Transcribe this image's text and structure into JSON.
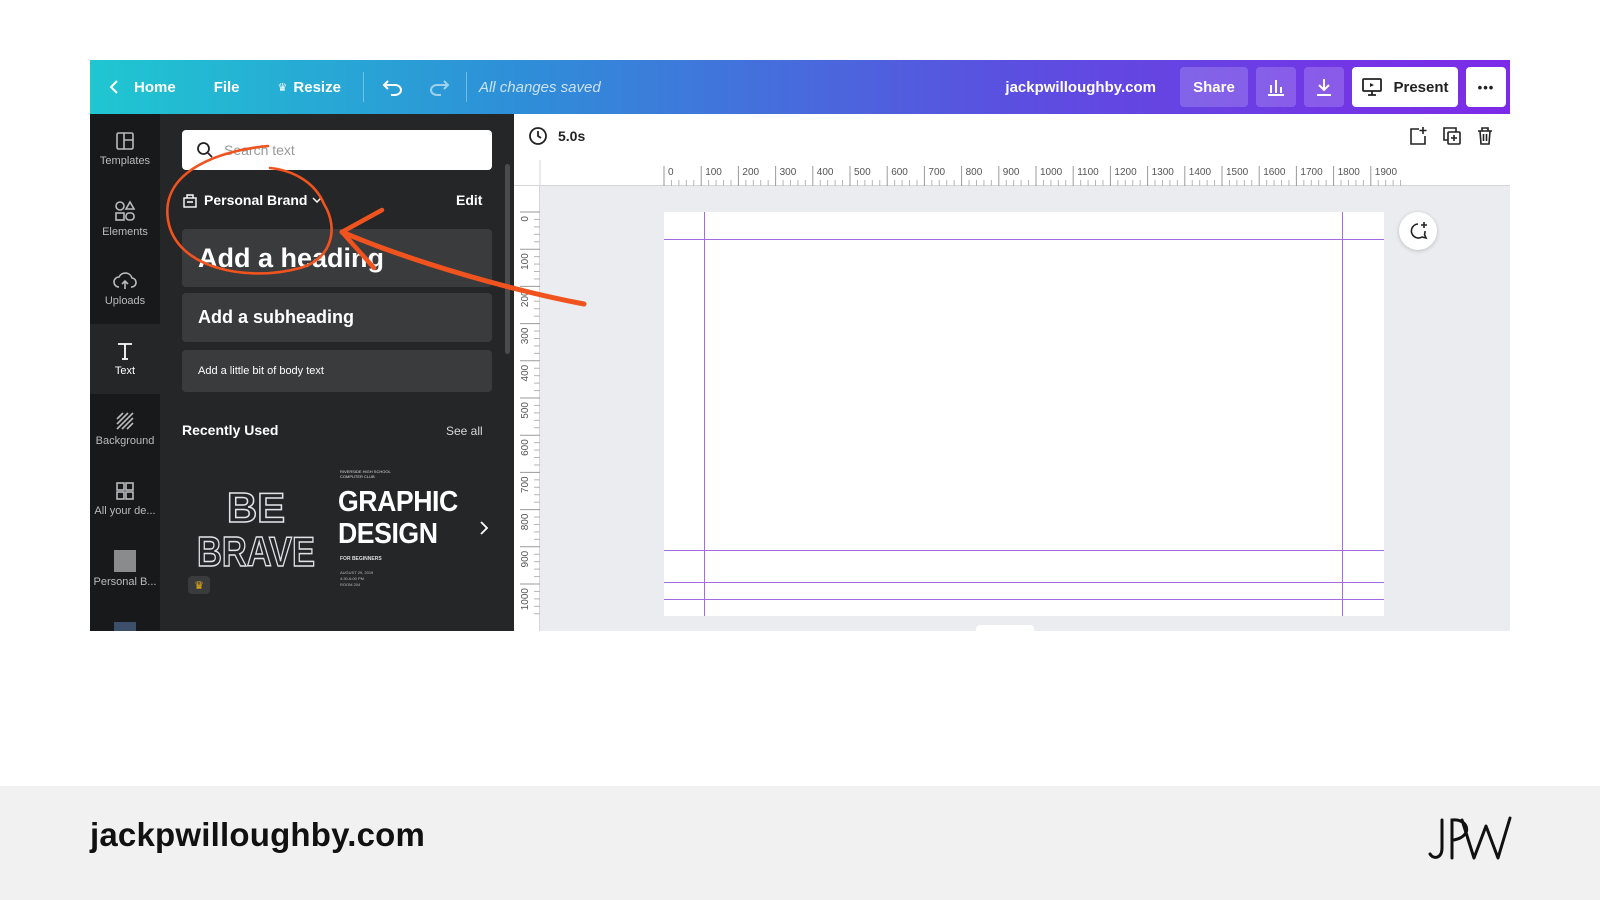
{
  "topbar": {
    "home_label": "Home",
    "file_label": "File",
    "resize_label": "Resize",
    "save_status": "All changes saved",
    "site_name": "jackpwilloughby.com",
    "share_label": "Share",
    "present_label": "Present",
    "more_label": "•••"
  },
  "rail": {
    "items": [
      {
        "label": "Templates",
        "icon": "templates-icon"
      },
      {
        "label": "Elements",
        "icon": "elements-icon"
      },
      {
        "label": "Uploads",
        "icon": "uploads-icon"
      },
      {
        "label": "Text",
        "icon": "text-icon",
        "active": true
      },
      {
        "label": "Background",
        "icon": "background-icon"
      },
      {
        "label": "All your de...",
        "icon": "folders-icon"
      },
      {
        "label": "Personal B...",
        "icon": "brand-thumbnail"
      }
    ]
  },
  "panel": {
    "search_placeholder": "Search text",
    "brand_label": "Personal Brand",
    "edit_label": "Edit",
    "heading_label": "Add a heading",
    "subheading_label": "Add a subheading",
    "body_label": "Add a little bit of body text",
    "recent_title": "Recently Used",
    "see_all_label": "See all",
    "recent_items": [
      {
        "line1": "BE",
        "line2": "BRAVE"
      },
      {
        "kicker": "RIVERSIDE HIGH SCHOOL COMPUTER CLUB",
        "line1": "GRAPHIC",
        "line2": "DESIGN",
        "sub": "FOR BEGINNERS",
        "meta1": "AUGUST 29, 2019",
        "meta2": "4:30-6:00 PM",
        "meta3": "ROOM 204"
      }
    ]
  },
  "editor": {
    "duration": "5.0s",
    "ruler_top_labels": [
      "0",
      "100",
      "200",
      "300",
      "400",
      "500",
      "600",
      "700",
      "800",
      "900",
      "1000",
      "1100",
      "1200",
      "1300",
      "1400",
      "1500",
      "1600",
      "1700",
      "1800",
      "1900"
    ],
    "ruler_left_labels": [
      "0",
      "100",
      "200",
      "300",
      "400",
      "500",
      "600",
      "700",
      "800",
      "900",
      "1000"
    ]
  },
  "footer": {
    "site": "jackpwilloughby.com",
    "logo": "JPW"
  },
  "colors": {
    "accent_purple": "#7d2ae8",
    "accent_teal": "#1fc7d1",
    "annotation_red": "#f1531f",
    "guide": "#a46be0"
  }
}
